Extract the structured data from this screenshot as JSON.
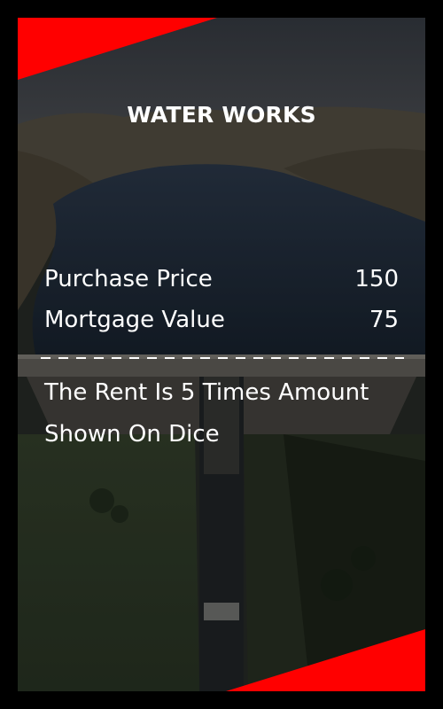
{
  "card": {
    "title": "WATER WORKS",
    "purchase_price_label": "Purchase Price",
    "purchase_price_value": "150",
    "mortgage_value_label": "Mortgage Value",
    "mortgage_value_value": "75",
    "rent_text": "The Rent Is 5 Times Amount Shown On Dice"
  },
  "colors": {
    "accent": "#ff0000",
    "frame": "#000000",
    "text": "#ffffff"
  },
  "background_image": "dam-reservoir-photo"
}
